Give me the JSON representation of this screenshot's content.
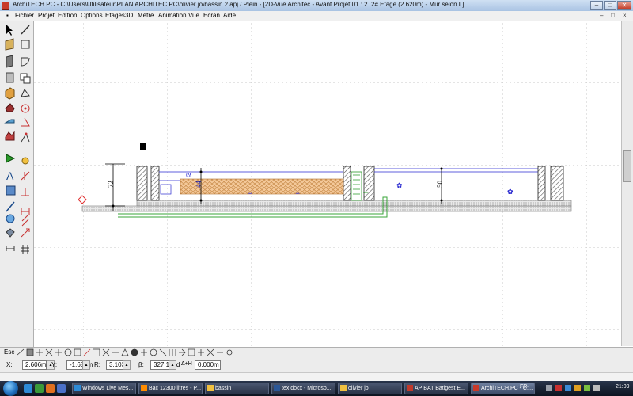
{
  "window": {
    "title": "ArchiTECH.PC - C:\\Users\\Utilisateur\\PLAN ARCHITEC PC\\olivier jo\\bassin 2.apj / Plein - [2D-Vue Architec - Avant Projet 01 : 2. 2# Etage (2.620m) - Mur selon L]",
    "controls": {
      "minimize": "–",
      "maximize": "□",
      "close": "✕"
    }
  },
  "menubar": {
    "items": [
      "Fichier",
      "Projet",
      "Edition",
      "Options",
      "Etages",
      "3D",
      "Métré",
      "Animation",
      "Vue",
      "Ecran",
      "Aide"
    ],
    "window_controls": [
      "–",
      "□",
      "×"
    ]
  },
  "drawing": {
    "dimension_left": "72",
    "label_fill": "44",
    "dimension_right": "50",
    "colors": {
      "wall_hatch": "#555555",
      "gravel_fill": "#f4c99a",
      "water_line": "#2a2ad0",
      "pipe": "#3aa63a",
      "ground": "#888888",
      "origin_marker": "#e03030"
    }
  },
  "bottom_toolbar": {
    "esc_label": "Esc"
  },
  "coordinates": {
    "x_label": "X:",
    "x_value": "2.606m",
    "y_label": "Y:",
    "y_value": "-1.684m",
    "r_label": "R:",
    "r_value": "3.103m",
    "b_label": "β:",
    "b_value": "327.135d",
    "h_label": "Δ+H",
    "h_value": "0.000m"
  },
  "taskbar": {
    "tasks": [
      {
        "label": "Windows Live Mes...",
        "color": "#2d8ad6"
      },
      {
        "label": "Bac 12300 litres - P...",
        "color": "#ff8c00"
      },
      {
        "label": "bassin",
        "color": "#f0c040"
      },
      {
        "label": "tex.docx - Microso...",
        "color": "#2b5797"
      },
      {
        "label": "olivier jo",
        "color": "#f0c040"
      },
      {
        "label": "APIBAT Batigest E...",
        "color": "#c0392b"
      },
      {
        "label": "ArchiTECH.PC - C:...",
        "color": "#c83a2a",
        "active": true
      }
    ],
    "language": "FR",
    "clock": "21:09"
  }
}
